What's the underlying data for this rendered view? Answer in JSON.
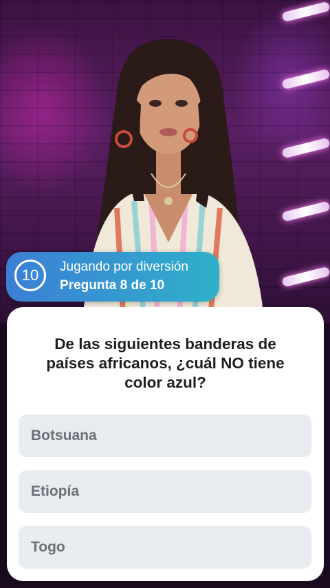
{
  "status": {
    "timer": "10",
    "mode": "Jugando por diversión",
    "progress": "Pregunta 8 de 10"
  },
  "question": {
    "text": "De las siguientes banderas de países africanos, ¿cuál NO tiene color azul?"
  },
  "options": [
    {
      "label": "Botsuana"
    },
    {
      "label": "Etiopía"
    },
    {
      "label": "Togo"
    }
  ],
  "colors": {
    "pill_start": "#3c7fd6",
    "pill_end": "#2fb0c9",
    "option_bg": "#e8ebef",
    "option_text": "#6b7077"
  }
}
